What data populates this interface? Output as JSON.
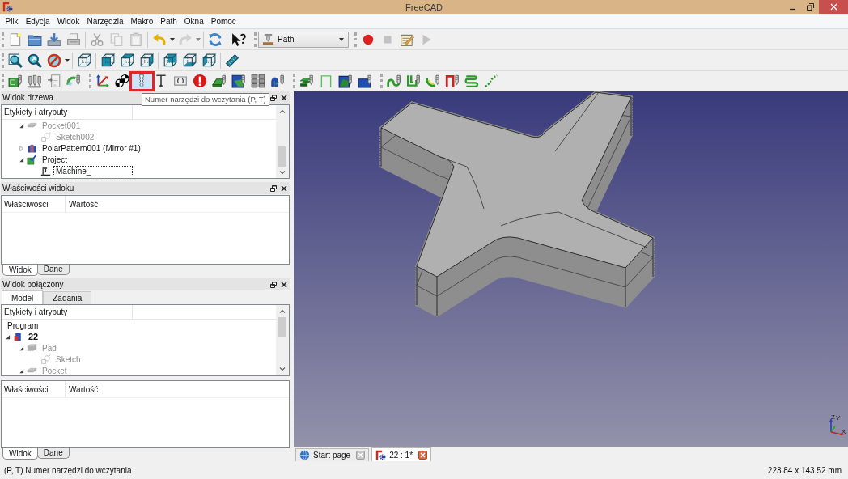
{
  "window": {
    "title": "FreeCAD"
  },
  "menu": [
    "Plik",
    "Edycja",
    "Widok",
    "Narzędzia",
    "Makro",
    "Path",
    "Okna",
    "Pomoc"
  ],
  "toolbars": [
    [
      {
        "kind": "buttons",
        "groups": [
          [
            {
              "kind": "new",
              "disabled": false,
              "highlighted": false
            },
            {
              "kind": "open",
              "disabled": false,
              "highlighted": false
            },
            {
              "kind": "save",
              "disabled": false,
              "highlighted": false
            },
            {
              "kind": "print",
              "disabled": false,
              "highlighted": false
            }
          ],
          [
            {
              "kind": "cut",
              "disabled": true,
              "highlighted": false
            },
            {
              "kind": "copy",
              "disabled": true,
              "highlighted": false
            },
            {
              "kind": "paste",
              "disabled": true,
              "highlighted": false
            }
          ],
          [
            {
              "kind": "undo",
              "disabled": false,
              "highlighted": false
            },
            {
              "kind": "dropdown",
              "disabled": false,
              "highlighted": false
            },
            {
              "kind": "redo",
              "disabled": true,
              "highlighted": false
            },
            {
              "kind": "dropdown",
              "disabled": true,
              "highlighted": false
            }
          ],
          [
            {
              "kind": "refresh",
              "disabled": false,
              "highlighted": false
            }
          ],
          [
            {
              "kind": "whats_this",
              "disabled": false,
              "highlighted": false
            }
          ]
        ]
      },
      {
        "kind": "workbench",
        "value": "Path"
      },
      {
        "kind": "buttons",
        "groups": [
          [
            {
              "kind": "record",
              "disabled": false,
              "highlighted": false
            },
            {
              "kind": "macro_stop",
              "disabled": true,
              "highlighted": false
            },
            {
              "kind": "macro_edit",
              "disabled": false,
              "highlighted": false
            },
            {
              "kind": "macro_run",
              "disabled": true,
              "highlighted": false
            }
          ]
        ]
      }
    ],
    [
      {
        "kind": "buttons",
        "groups": [
          [
            {
              "kind": "fit_all",
              "disabled": false,
              "highlighted": false
            },
            {
              "kind": "zoom_box",
              "disabled": false,
              "highlighted": false
            },
            {
              "kind": "draw_style",
              "disabled": false,
              "highlighted": false
            },
            {
              "kind": "dropdown",
              "disabled": false,
              "highlighted": false
            }
          ],
          [
            {
              "kind": "view_iso",
              "disabled": false,
              "highlighted": false
            }
          ],
          [
            {
              "kind": "view_front",
              "disabled": false,
              "highlighted": false
            },
            {
              "kind": "view_top",
              "disabled": false,
              "highlighted": false
            },
            {
              "kind": "view_right",
              "disabled": false,
              "highlighted": false
            }
          ],
          [
            {
              "kind": "view_rear",
              "disabled": false,
              "highlighted": false
            },
            {
              "kind": "view_bottom",
              "disabled": false,
              "highlighted": false
            },
            {
              "kind": "view_left",
              "disabled": false,
              "highlighted": false
            }
          ],
          [
            {
              "kind": "measure",
              "disabled": false,
              "highlighted": false
            }
          ]
        ]
      }
    ],
    [
      {
        "kind": "buttons",
        "groups": [
          [
            {
              "kind": "job",
              "disabled": false,
              "highlighted": false
            },
            {
              "kind": "post",
              "disabled": false,
              "highlighted": false
            },
            {
              "kind": "export",
              "disabled": false,
              "highlighted": false
            },
            {
              "kind": "simulate",
              "disabled": false,
              "highlighted": false
            }
          ]
        ]
      },
      {
        "kind": "buttons",
        "groups": [
          [
            {
              "kind": "datum",
              "disabled": false,
              "highlighted": false
            },
            {
              "kind": "discs",
              "disabled": false,
              "highlighted": false
            },
            {
              "kind": "load_tool",
              "disabled": false,
              "highlighted": true
            },
            {
              "kind": "probe",
              "disabled": false,
              "highlighted": false
            },
            {
              "kind": "comment",
              "disabled": false,
              "highlighted": false
            },
            {
              "kind": "alert",
              "disabled": false,
              "highlighted": false
            },
            {
              "kind": "face",
              "disabled": false,
              "highlighted": false
            },
            {
              "kind": "pocket_frame",
              "disabled": false,
              "highlighted": false
            },
            {
              "kind": "array",
              "disabled": false,
              "highlighted": false
            },
            {
              "kind": "profile",
              "disabled": false,
              "highlighted": false
            }
          ]
        ]
      },
      {
        "kind": "buttons",
        "groups": [
          [
            {
              "kind": "stack",
              "disabled": false,
              "highlighted": false
            },
            {
              "kind": "bracket",
              "disabled": false,
              "highlighted": false
            },
            {
              "kind": "area",
              "disabled": false,
              "highlighted": false
            },
            {
              "kind": "pocket_tool",
              "disabled": false,
              "highlighted": false
            }
          ]
        ]
      },
      {
        "kind": "buttons",
        "groups": [
          [
            {
              "kind": "contour",
              "disabled": false,
              "highlighted": false
            },
            {
              "kind": "u_path",
              "disabled": false,
              "highlighted": false
            },
            {
              "kind": "arc_path",
              "disabled": false,
              "highlighted": false
            },
            {
              "kind": "step_path",
              "disabled": false,
              "highlighted": false
            },
            {
              "kind": "waves",
              "disabled": false,
              "highlighted": false
            },
            {
              "kind": "dashed",
              "disabled": false,
              "highlighted": false
            }
          ]
        ]
      }
    ]
  ],
  "tooltip": {
    "text": "Numer narzędzi do wczytania (P, T)"
  },
  "tree_view": {
    "title": "Widok drzewa",
    "header": "Etykiety i atrybuty",
    "items": [
      {
        "label": "Pocket001",
        "kind": "pocket",
        "visible": false,
        "expanded": true,
        "focused": false,
        "children": [
          {
            "label": "Sketch002",
            "kind": "sketch",
            "visible": false,
            "focused": false
          }
        ]
      },
      {
        "label": "PolarPattern001 (Mirror #1)",
        "kind": "polar_pattern",
        "visible": true,
        "expanded": false,
        "focused": false
      },
      {
        "label": "Project",
        "kind": "project",
        "visible": true,
        "expanded": true,
        "focused": false,
        "children": [
          {
            "label": "Machine_",
            "kind": "machine",
            "visible": true,
            "focused": true
          }
        ]
      }
    ]
  },
  "property_view": {
    "title": "Właściwości widoku",
    "columns": [
      "Właściwości",
      "Wartość"
    ],
    "tabs": [
      {
        "label": "Widok",
        "selected": true
      },
      {
        "label": "Dane",
        "selected": false
      }
    ]
  },
  "combo_view": {
    "title": "Widok połączony",
    "tabs": [
      {
        "label": "Model",
        "selected": true
      },
      {
        "label": "Zadania",
        "selected": false
      }
    ],
    "tree": {
      "header": "Etykiety i atrybuty",
      "items": [
        {
          "label": "Program",
          "kind": "root",
          "visible": true,
          "focused": false,
          "children": [
            {
              "label": "22",
              "kind": "document",
              "visible": true,
              "expanded": true,
              "focused": false,
              "children": [
                {
                  "label": "Pad",
                  "kind": "pad",
                  "visible": false,
                  "expanded": true,
                  "focused": false,
                  "children": [
                    {
                      "label": "Sketch",
                      "kind": "sketch",
                      "visible": false,
                      "focused": false
                    }
                  ]
                },
                {
                  "label": "Pocket",
                  "kind": "pocket",
                  "visible": false,
                  "expanded": true,
                  "focused": false
                }
              ]
            }
          ]
        }
      ]
    },
    "properties": {
      "columns": [
        "Właściwości",
        "Wartość"
      ],
      "tabs": [
        {
          "label": "Widok",
          "selected": true
        },
        {
          "label": "Dane",
          "selected": false
        }
      ]
    }
  },
  "view_3d": {
    "axis_labels": {
      "x": "X",
      "y": "Y",
      "z": "Z"
    }
  },
  "document_tabs": [
    {
      "label": "Start page",
      "kind": "web",
      "selected": false
    },
    {
      "label": "22 : 1*",
      "kind": "document",
      "selected": true
    }
  ],
  "status_bar": {
    "message": "(P, T) Numer narzędzi do wczytania",
    "dimensions": "223.84 x 143.52 mm"
  }
}
